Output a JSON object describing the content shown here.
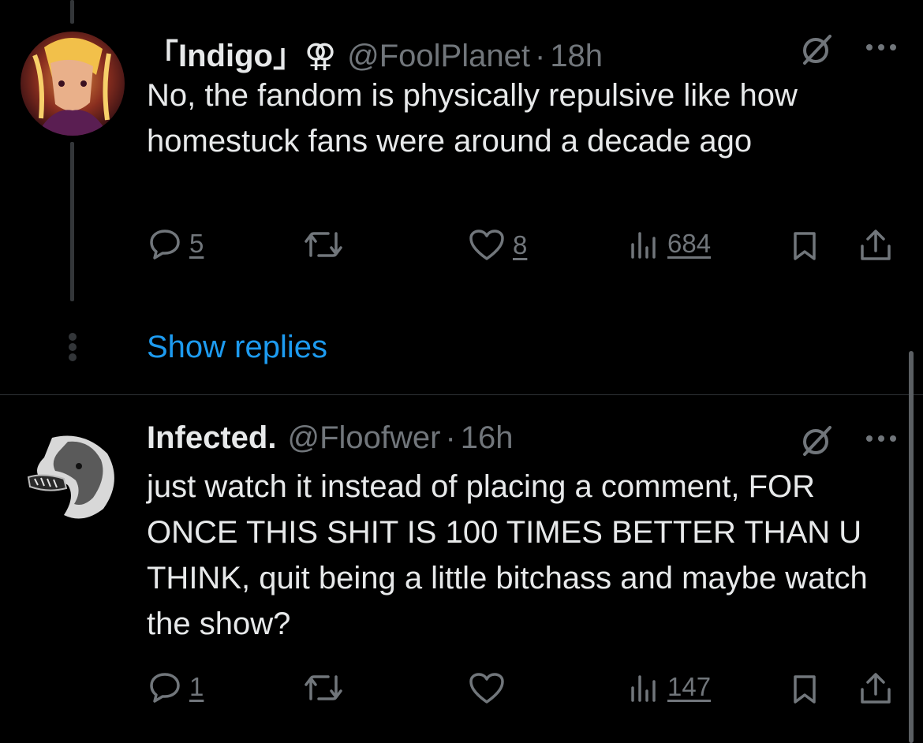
{
  "tweets": [
    {
      "display_name": "「Indigo」⚢",
      "handle": "@FoolPlanet",
      "time": "18h",
      "text": "No, the fandom is physically repulsive like how homestuck fans were around a decade ago",
      "replies": "5",
      "retweets": "",
      "likes": "8",
      "views": "684"
    },
    {
      "display_name": "Infected.",
      "handle": "@Floofwer",
      "time": "16h",
      "text": "just watch it instead of placing a comment, FOR ONCE THIS SHIT IS 100 TIMES BETTER THAN U THINK, quit being a little bitchass and maybe watch the show?",
      "replies": "1",
      "retweets": "",
      "likes": "",
      "views": "147"
    }
  ],
  "show_replies_label": "Show replies",
  "separator": "·",
  "colors": {
    "accent": "#1d9bf0",
    "muted": "#71767b",
    "text": "#e7e9ea",
    "background": "#000000"
  }
}
